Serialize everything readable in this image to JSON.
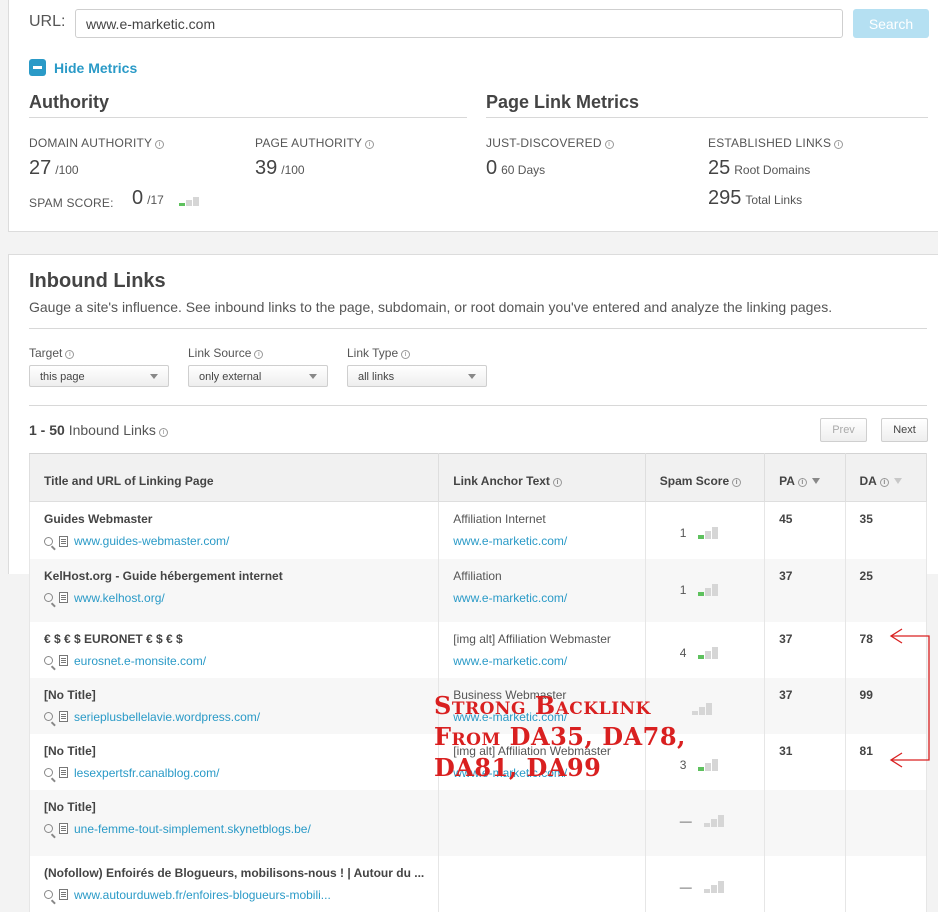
{
  "search": {
    "url_label": "URL:",
    "url_value": "www.e-marketic.com",
    "button_label": "Search"
  },
  "hide_metrics_label": "Hide Metrics",
  "authority": {
    "heading": "Authority",
    "domain_authority": {
      "label": "DOMAIN AUTHORITY",
      "value": "27",
      "suffix": "/100"
    },
    "page_authority": {
      "label": "PAGE AUTHORITY",
      "value": "39",
      "suffix": "/100"
    },
    "spam_score": {
      "label": "SPAM SCORE:",
      "value": "0",
      "suffix": "/17"
    }
  },
  "page_link_metrics": {
    "heading": "Page Link Metrics",
    "just_discovered": {
      "label": "JUST-DISCOVERED",
      "value": "0",
      "suffix": "60 Days"
    },
    "established_links": {
      "label": "ESTABLISHED LINKS",
      "root_domains_value": "25",
      "root_domains_suffix": "Root Domains",
      "total_links_value": "295",
      "total_links_suffix": "Total Links"
    }
  },
  "inbound": {
    "title": "Inbound Links",
    "description": "Gauge a site's influence. See inbound links to the page, subdomain, or root domain you've entered and analyze the linking pages.",
    "filters": {
      "target": {
        "label": "Target",
        "value": "this page"
      },
      "link_source": {
        "label": "Link Source",
        "value": "only external"
      },
      "link_type": {
        "label": "Link Type",
        "value": "all links"
      }
    },
    "count_range": "1 - 50",
    "count_label": "Inbound Links",
    "prev_label": "Prev",
    "next_label": "Next"
  },
  "table": {
    "columns": {
      "title_url": "Title and URL of Linking Page",
      "anchor": "Link Anchor Text",
      "spam": "Spam Score",
      "pa": "PA",
      "da": "DA"
    },
    "rows": [
      {
        "title": "Guides Webmaster",
        "url": "www.guides-webmaster.com/",
        "anchor_text": "Affiliation Internet",
        "anchor_url": "www.e-marketic.com/",
        "spam": "1",
        "pa": "45",
        "da": "35"
      },
      {
        "title": "KelHost.org - Guide hébergement internet",
        "url": "www.kelhost.org/",
        "anchor_text": "Affiliation",
        "anchor_url": "www.e-marketic.com/",
        "spam": "1",
        "pa": "37",
        "da": "25"
      },
      {
        "title": "€ $ € $ EURONET € $ € $",
        "url": "eurosnet.e-monsite.com/",
        "anchor_text": "[img alt] Affiliation Webmaster",
        "anchor_url": "www.e-marketic.com/",
        "spam": "4",
        "pa": "37",
        "da": "78"
      },
      {
        "title": "[No Title]",
        "url": "serieplusbellelavie.wordpress.com/",
        "anchor_text": "Business Webmaster",
        "anchor_url": "www.e-marketic.com/",
        "spam": "",
        "pa": "37",
        "da": "99"
      },
      {
        "title": "[No Title]",
        "url": "lesexpertsfr.canalblog.com/",
        "anchor_text": "[img alt] Affiliation Webmaster",
        "anchor_url": "www.e-marketic.com/",
        "spam": "3",
        "pa": "31",
        "da": "81"
      },
      {
        "title": "[No Title]",
        "url": "une-femme-tout-simplement.skynetblogs.be/",
        "anchor_text": "",
        "anchor_url": "",
        "spam": "—",
        "pa": "",
        "da": ""
      },
      {
        "title": "(Nofollow) Enfoirés de Blogueurs, mobilisons-nous ! | Autour du ...",
        "url": "www.autourduweb.fr/enfoires-blogueurs-mobili...",
        "anchor_text": "",
        "anchor_url": "",
        "spam": "—",
        "pa": "",
        "da": ""
      }
    ]
  },
  "annotation": {
    "line1": "Strong Backlink",
    "line2": "From DA35, DA78,",
    "line3": "DA81, DA99",
    "color": "#d92020"
  }
}
